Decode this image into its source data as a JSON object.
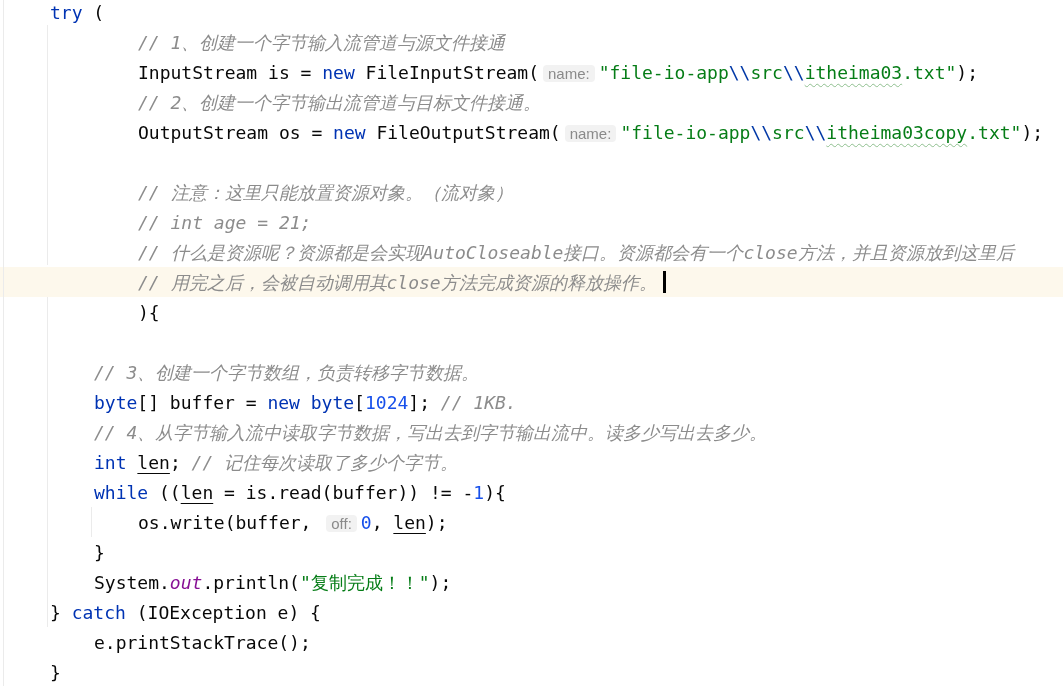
{
  "editor": {
    "lines": [
      {
        "kind": "outer",
        "tokens": [
          {
            "kind": "keyword",
            "text": "try"
          },
          {
            "kind": "plain",
            "text": " ("
          }
        ]
      },
      {
        "kind": "resource",
        "tokens": [
          {
            "kind": "comment",
            "text": "// 1、创建一个字节输入流管道与源文件接通"
          }
        ]
      },
      {
        "kind": "resource",
        "tokens": [
          {
            "kind": "plain",
            "text": "InputStream is = "
          },
          {
            "kind": "keyword",
            "text": "new"
          },
          {
            "kind": "plain",
            "text": " FileInputStream("
          },
          {
            "kind": "hint",
            "text": "name:"
          },
          {
            "kind": "string",
            "text": "\"file-io-app"
          },
          {
            "kind": "escape",
            "text": "\\\\"
          },
          {
            "kind": "string",
            "text": "src"
          },
          {
            "kind": "escape",
            "text": "\\\\"
          },
          {
            "kind": "typo",
            "text": "itheima03"
          },
          {
            "kind": "string",
            "text": ".txt\""
          },
          {
            "kind": "plain",
            "text": ");"
          }
        ]
      },
      {
        "kind": "resource",
        "tokens": [
          {
            "kind": "comment",
            "text": "// 2、创建一个字节输出流管道与目标文件接通。"
          }
        ]
      },
      {
        "kind": "resource",
        "tokens": [
          {
            "kind": "plain",
            "text": "OutputStream os = "
          },
          {
            "kind": "keyword",
            "text": "new"
          },
          {
            "kind": "plain",
            "text": " FileOutputStream("
          },
          {
            "kind": "hint",
            "text": "name:"
          },
          {
            "kind": "string",
            "text": "\"file-io-app"
          },
          {
            "kind": "escape",
            "text": "\\\\"
          },
          {
            "kind": "string",
            "text": "src"
          },
          {
            "kind": "escape",
            "text": "\\\\"
          },
          {
            "kind": "typo",
            "text": "itheima03copy"
          },
          {
            "kind": "string",
            "text": ".txt\""
          },
          {
            "kind": "plain",
            "text": ");"
          }
        ]
      },
      {
        "kind": "blank"
      },
      {
        "kind": "resource",
        "tokens": [
          {
            "kind": "comment",
            "text": "// 注意：这里只能放置资源对象。（流对象）"
          }
        ]
      },
      {
        "kind": "resource",
        "tokens": [
          {
            "kind": "comment",
            "text": "// int age = 21;"
          }
        ]
      },
      {
        "kind": "resource",
        "tokens": [
          {
            "kind": "comment",
            "text": "// 什么是资源呢？资源都是会实现AutoCloseable接口。资源都会有一个close方法，并且资源放到这里后"
          }
        ]
      },
      {
        "kind": "resource",
        "current": true,
        "caret": true,
        "tokens": [
          {
            "kind": "comment",
            "text": "// 用完之后，会被自动调用其close方法完成资源的释放操作。"
          }
        ]
      },
      {
        "kind": "resource",
        "tokens": [
          {
            "kind": "plain",
            "text": "){"
          }
        ]
      },
      {
        "kind": "blank"
      },
      {
        "kind": "body",
        "tokens": [
          {
            "kind": "comment",
            "text": "// 3、创建一个字节数组，负责转移字节数据。"
          }
        ]
      },
      {
        "kind": "body",
        "tokens": [
          {
            "kind": "keyword",
            "text": "byte"
          },
          {
            "kind": "plain",
            "text": "[] buffer = "
          },
          {
            "kind": "keyword",
            "text": "new byte"
          },
          {
            "kind": "plain",
            "text": "["
          },
          {
            "kind": "number",
            "text": "1024"
          },
          {
            "kind": "plain",
            "text": "]; "
          },
          {
            "kind": "comment",
            "text": "// 1KB."
          }
        ]
      },
      {
        "kind": "body",
        "tokens": [
          {
            "kind": "comment",
            "text": "// 4、从字节输入流中读取字节数据，写出去到字节输出流中。读多少写出去多少。"
          }
        ]
      },
      {
        "kind": "body",
        "tokens": [
          {
            "kind": "keyword",
            "text": "int "
          },
          {
            "kind": "variable",
            "text": "len"
          },
          {
            "kind": "plain",
            "text": "; "
          },
          {
            "kind": "comment",
            "text": "// 记住每次读取了多少个字节。"
          }
        ]
      },
      {
        "kind": "body",
        "tokens": [
          {
            "kind": "keyword",
            "text": "while"
          },
          {
            "kind": "plain",
            "text": " (("
          },
          {
            "kind": "variable",
            "text": "len"
          },
          {
            "kind": "plain",
            "text": " = is.read(buffer)) != -"
          },
          {
            "kind": "number",
            "text": "1"
          },
          {
            "kind": "plain",
            "text": "){"
          }
        ]
      },
      {
        "kind": "inner",
        "tokens": [
          {
            "kind": "plain",
            "text": "os.write(buffer, "
          },
          {
            "kind": "hint",
            "text": "off:"
          },
          {
            "kind": "number",
            "text": "0"
          },
          {
            "kind": "plain",
            "text": ", "
          },
          {
            "kind": "variable",
            "text": "len"
          },
          {
            "kind": "plain",
            "text": ");"
          }
        ]
      },
      {
        "kind": "body",
        "tokens": [
          {
            "kind": "plain",
            "text": "}"
          }
        ]
      },
      {
        "kind": "body",
        "tokens": [
          {
            "kind": "plain",
            "text": "System."
          },
          {
            "kind": "static",
            "text": "out"
          },
          {
            "kind": "plain",
            "text": ".println("
          },
          {
            "kind": "string",
            "text": "\"复制完成！！\""
          },
          {
            "kind": "plain",
            "text": ");"
          }
        ]
      },
      {
        "kind": "outer",
        "tokens": [
          {
            "kind": "plain",
            "text": "} "
          },
          {
            "kind": "keyword",
            "text": "catch"
          },
          {
            "kind": "plain",
            "text": " (IOException e) {"
          }
        ]
      },
      {
        "kind": "body",
        "tokens": [
          {
            "kind": "plain",
            "text": "e.printStackTrace();"
          }
        ]
      },
      {
        "kind": "outer",
        "tokens": [
          {
            "kind": "plain",
            "text": "}"
          }
        ]
      }
    ]
  }
}
